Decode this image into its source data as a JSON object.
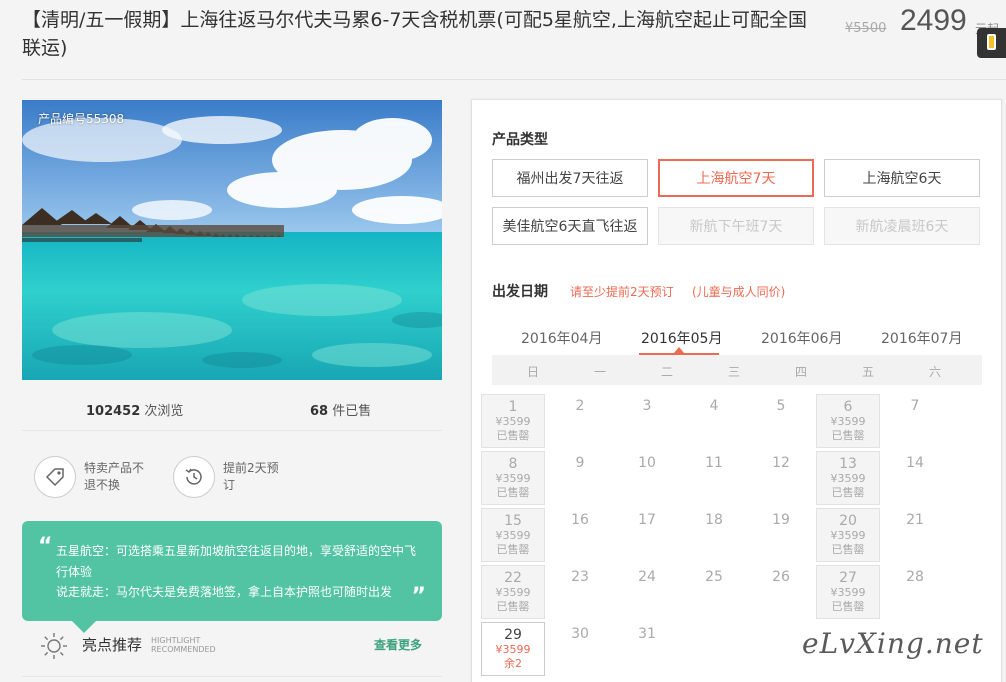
{
  "title": "【清明/五一假期】上海往返马尔代夫马累6-7天含税机票(可配5星航空,上海航空起止可配全国联运)",
  "price": {
    "original": "¥5500",
    "current": "2499",
    "unit": "元起"
  },
  "photo": {
    "product_no": "产品编号55308"
  },
  "stats": {
    "views_num": "102452",
    "views_label": " 次浏览",
    "sold_num": "68",
    "sold_label": " 件已售"
  },
  "features": [
    {
      "icon": "tag-icon",
      "text": "特卖产品不退不换"
    },
    {
      "icon": "clock-history-icon",
      "text": "提前2天预订"
    }
  ],
  "quote": {
    "line1": "五星航空：可选搭乘五星新加坡航空往返目的地，享受舒适的空中飞行体验",
    "line2": "说走就走：马尔代夫是免费落地签，拿上自本护照也可随时出发"
  },
  "highlights": {
    "label": "亮点推荐",
    "en_line1": "HIGHTLIGHT",
    "en_line2": "RECOMMENDED",
    "more": "查看更多"
  },
  "product_type": {
    "title": "产品类型",
    "options": [
      {
        "label": "福州出发7天往返",
        "state": "normal"
      },
      {
        "label": "上海航空7天",
        "state": "active"
      },
      {
        "label": "上海航空6天",
        "state": "normal"
      },
      {
        "label": "美佳航空6天直飞往返",
        "state": "normal"
      },
      {
        "label": "新航下午班7天",
        "state": "disabled"
      },
      {
        "label": "新航凌晨班6天",
        "state": "disabled"
      }
    ]
  },
  "departure": {
    "title": "出发日期",
    "note1": "请至少提前2天预订",
    "note2": "(儿童与成人同价)"
  },
  "months": [
    "2016年04月",
    "2016年05月",
    "2016年06月",
    "2016年07月"
  ],
  "weekdays": [
    "日",
    "一",
    "二",
    "三",
    "四",
    "五",
    "六"
  ],
  "calendar": [
    {
      "day": "1",
      "price": "¥3599",
      "status": "已售罄"
    },
    {
      "day": "2"
    },
    {
      "day": "3"
    },
    {
      "day": "4"
    },
    {
      "day": "5"
    },
    {
      "day": "6",
      "price": "¥3599",
      "status": "已售罄"
    },
    {
      "day": "7"
    },
    {
      "day": "8",
      "price": "¥3599",
      "status": "已售罄"
    },
    {
      "day": "9"
    },
    {
      "day": "10"
    },
    {
      "day": "11"
    },
    {
      "day": "12"
    },
    {
      "day": "13",
      "price": "¥3599",
      "status": "已售罄"
    },
    {
      "day": "14"
    },
    {
      "day": "15",
      "price": "¥3599",
      "status": "已售罄"
    },
    {
      "day": "16"
    },
    {
      "day": "17"
    },
    {
      "day": "18"
    },
    {
      "day": "19"
    },
    {
      "day": "20",
      "price": "¥3599",
      "status": "已售罄"
    },
    {
      "day": "21"
    },
    {
      "day": "22",
      "price": "¥3599",
      "status": "已售罄"
    },
    {
      "day": "23"
    },
    {
      "day": "24"
    },
    {
      "day": "25"
    },
    {
      "day": "26"
    },
    {
      "day": "27",
      "price": "¥3599",
      "status": "已售罄"
    },
    {
      "day": "28"
    },
    {
      "day": "29",
      "price": "¥3599",
      "status": "余2",
      "available": true
    },
    {
      "day": "30"
    },
    {
      "day": "31"
    }
  ],
  "watermark": "eLvXing.net"
}
